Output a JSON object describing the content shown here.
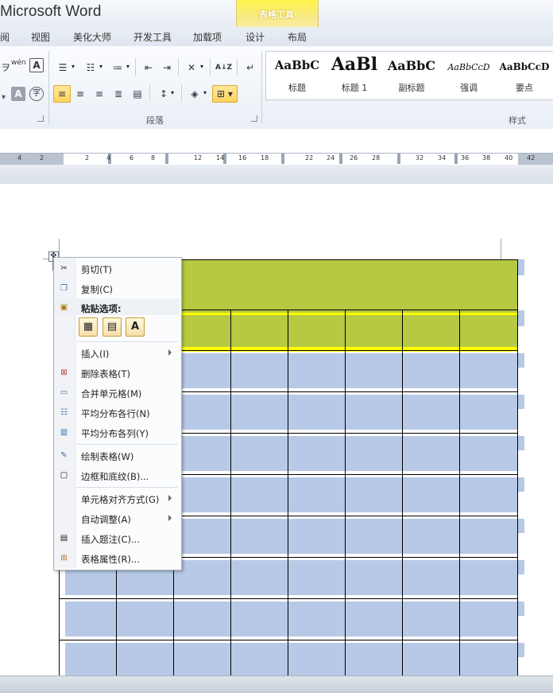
{
  "app": {
    "title": "Microsoft Word",
    "context_group": "表格工具"
  },
  "tabs": [
    {
      "label": "阅"
    },
    {
      "label": "视图"
    },
    {
      "label": "美化大师"
    },
    {
      "label": "开发工具"
    },
    {
      "label": "加载项"
    },
    {
      "label": "设计"
    },
    {
      "label": "布局"
    }
  ],
  "ribbon": {
    "font_glyphs": {
      "wen": "wén",
      "a_box": "A",
      "char_shade": "A",
      "circle_char": "字"
    },
    "sort_label": "A↓Z",
    "groups": {
      "paragraph": "段落",
      "styles": "样式"
    },
    "styles": [
      {
        "preview": "AaBbC",
        "label": "标题"
      },
      {
        "preview": "AaBl",
        "label": "标题 1"
      },
      {
        "preview": "AaBbC",
        "label": "副标题"
      },
      {
        "preview": "AaBbCcD",
        "label": "强调"
      },
      {
        "preview": "AaBbCcD",
        "label": "要点"
      }
    ]
  },
  "ruler": {
    "numbers": [
      "4",
      "2",
      "2",
      "4",
      "6",
      "8",
      "12",
      "14",
      "16",
      "18",
      "22",
      "24",
      "26",
      "28",
      "32",
      "34",
      "36",
      "38",
      "40",
      "42"
    ]
  },
  "context_menu": {
    "items": [
      {
        "label": "剪切(T)",
        "icon": "scissors-icon"
      },
      {
        "label": "复制(C)",
        "icon": "copy-icon"
      },
      {
        "label": "粘贴选项:",
        "icon": "paste-icon"
      },
      {
        "label": "插入(I)",
        "icon": ""
      },
      {
        "label": "删除表格(T)",
        "icon": "delete-table-icon"
      },
      {
        "label": "合并单元格(M)",
        "icon": "merge-cells-icon"
      },
      {
        "label": "平均分布各行(N)",
        "icon": "distribute-rows-icon"
      },
      {
        "label": "平均分布各列(Y)",
        "icon": "distribute-columns-icon"
      },
      {
        "label": "绘制表格(W)",
        "icon": "draw-table-icon"
      },
      {
        "label": "边框和底纹(B)...",
        "icon": "borders-icon"
      },
      {
        "label": "单元格对齐方式(G)",
        "icon": ""
      },
      {
        "label": "自动调整(A)",
        "icon": ""
      },
      {
        "label": "插入题注(C)...",
        "icon": "caption-icon"
      },
      {
        "label": "表格属性(R)...",
        "icon": "table-properties-icon"
      }
    ],
    "paste_option_text": "A"
  },
  "colors": {
    "header_green": "#b7c842",
    "row_blue": "#b7c9e6",
    "header_yellow": "#ffff00"
  }
}
